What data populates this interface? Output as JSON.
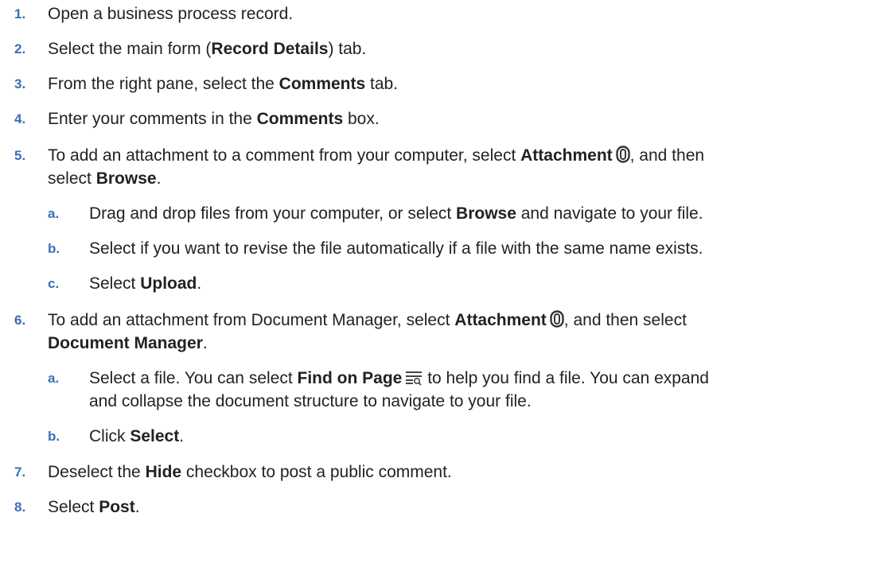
{
  "steps": [
    {
      "num": "1.",
      "parts": [
        "Open a business process record."
      ]
    },
    {
      "num": "2.",
      "pre": "Select the main form (",
      "bold": "Record Details",
      "post": ") tab."
    },
    {
      "num": "3.",
      "pre": "From the right pane, select the ",
      "bold": "Comments",
      "post": " tab."
    },
    {
      "num": "4.",
      "pre": "Enter your comments in the ",
      "bold": "Comments",
      "post": " box."
    },
    {
      "num": "5.",
      "line1_pre": "To add an attachment to a comment from your computer, select ",
      "line1_bold": "Attachment",
      "line1_post": ", and then",
      "line2_pre": "select ",
      "line2_bold": "Browse",
      "line2_post": "."
    },
    {
      "num": "6.",
      "line1_pre": "To add an attachment from Document Manager, select ",
      "line1_bold": "Attachment",
      "line1_post": ", and then select",
      "line2_bold": "Document Manager",
      "line2_post": "."
    },
    {
      "num": "7.",
      "pre": "Deselect the ",
      "bold": "Hide",
      "post": " checkbox to post a public comment."
    },
    {
      "num": "8.",
      "pre": "Select ",
      "bold": "Post",
      "post": "."
    }
  ],
  "sub5": [
    {
      "num": "a.",
      "pre": "Drag and drop files from your computer, or select ",
      "bold": "Browse",
      "post": " and navigate to your file."
    },
    {
      "num": "b.",
      "text": "Select if you want to revise the file automatically if a file with the same name exists."
    },
    {
      "num": "c.",
      "pre": "Select ",
      "bold": "Upload",
      "post": "."
    }
  ],
  "sub6": [
    {
      "num": "a.",
      "line1_pre": "Select a file. You can select ",
      "line1_bold": "Find on Page",
      "line1_post": " to help you find a file. You can expand",
      "line2": "and collapse the document structure to navigate to your file."
    },
    {
      "num": "b.",
      "pre": "Click ",
      "bold": "Select",
      "post": "."
    }
  ],
  "icons": {
    "attachment": "paperclip-icon",
    "find_on_page": "find-on-page-icon"
  }
}
